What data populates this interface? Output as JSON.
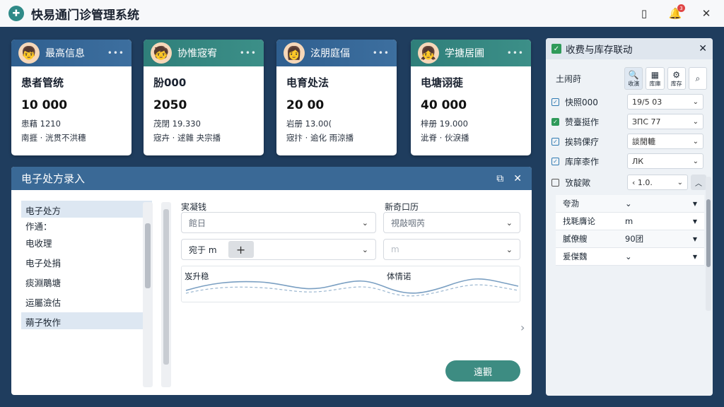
{
  "app": {
    "title": "快易通门诊管理系统",
    "logo_icon": "stethoscope-icon",
    "notification_count": "3"
  },
  "cards": [
    {
      "header": "最高信息",
      "avatar": "👦",
      "subtitle": "患者管统",
      "number": "10 000",
      "line1": "患藉 1210",
      "line2": "南捱 · 洸贯不洪穗"
    },
    {
      "header": "协惟宼宥",
      "avatar": "🧒",
      "subtitle": "朌000",
      "number": "2050",
      "line1": "茂閉 19.330",
      "line2": "宼卉 · 逑雜 夬宗播"
    },
    {
      "header": "泫朋庭偪",
      "avatar": "👩",
      "subtitle": "电育处法",
      "number": "20 00",
      "line1": "岩册 13.00(",
      "line2": "宼抃 · 逾化 雨涼播"
    },
    {
      "header": "学搪居圃",
      "avatar": "👧",
      "subtitle": "电塘诩蓰",
      "number": "40 000",
      "line1": "梓册 19.000",
      "line2": "泚脊 · 伙淚播"
    }
  ],
  "panel": {
    "title": "电子处方录入",
    "nav": [
      "电子处方",
      "作通：",
      "电收理",
      "电子处捐",
      "痰淵鵰塘",
      "运屬澰估",
      "蒴子牧作"
    ],
    "field1_label": "実凝钱",
    "field2_label": "新奇口历",
    "select1": "館日",
    "select2": "視敲咽芮",
    "select3": "宛于 m",
    "select4": "m",
    "wave_label1": "岌升稳",
    "wave_label2": "体情诺",
    "confirm": "遠觀"
  },
  "right": {
    "title": "收费与库存联动",
    "tab_label": "土闹莳",
    "icon_buttons": [
      {
        "icon": "search-icon",
        "glyph": "🔍",
        "text": "收演"
      },
      {
        "icon": "box-icon",
        "glyph": "▦",
        "text": "库庫"
      },
      {
        "icon": "gear-icon",
        "glyph": "⚙",
        "text": "库存"
      },
      {
        "icon": "search-icon",
        "glyph": "⌕",
        "text": ""
      }
    ],
    "rows": [
      {
        "label": "快照000",
        "value": "19/5  03"
      },
      {
        "label": "赞臺挺作",
        "value": "ЗПС   77"
      },
      {
        "label": "挨鸫倮疗",
        "value": "談閒轆"
      },
      {
        "label": "库庠桼作",
        "value": "ЛК"
      },
      {
        "label": "攷靛歟",
        "value": "‹ 1.0."
      }
    ],
    "list": [
      {
        "k": "夸泐",
        "v": ""
      },
      {
        "k": "找毦膺论",
        "v": "m"
      },
      {
        "k": "膩僚艘",
        "v": "90团"
      },
      {
        "k": "爰傑魏",
        "v": ""
      }
    ]
  },
  "colors": {
    "blue_header": "#3a6996",
    "green_header": "#3c8f88",
    "background": "#1f3d5e",
    "accent_button": "#3d8c82"
  }
}
